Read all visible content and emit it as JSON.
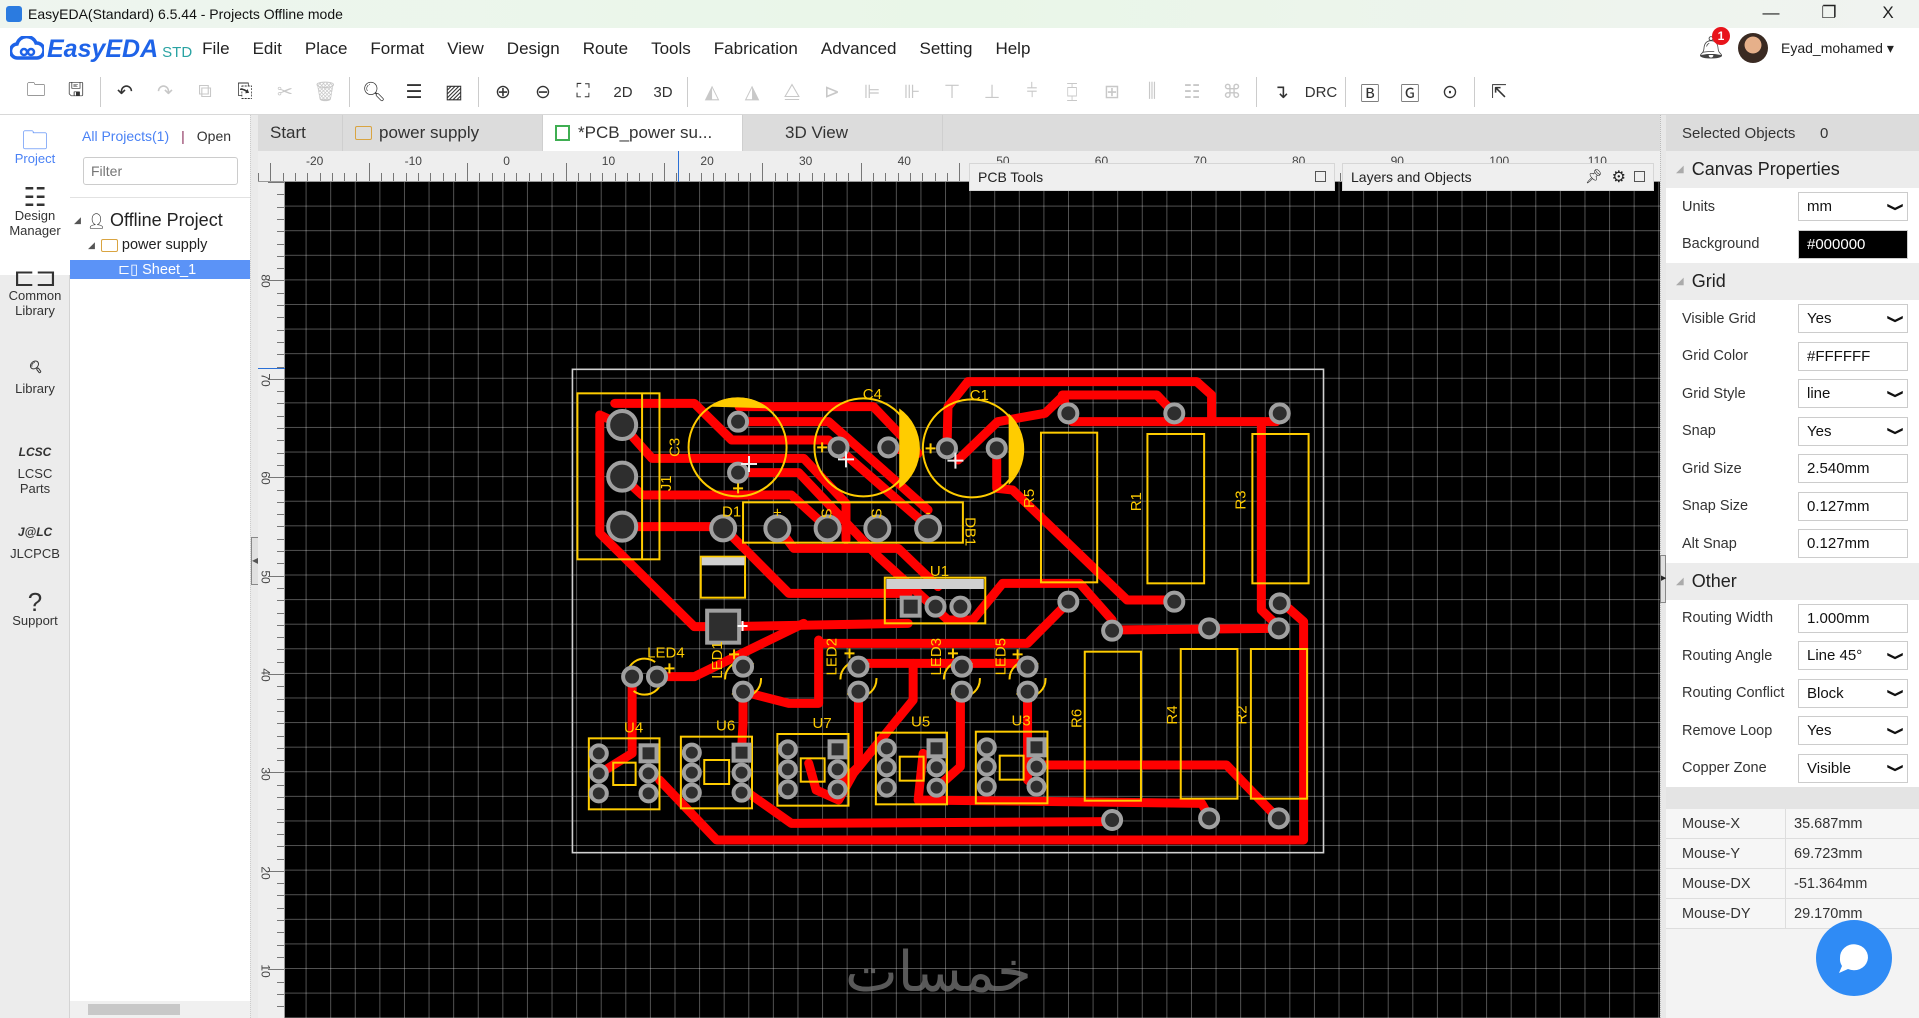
{
  "window": {
    "title": "EasyEDA(Standard) 6.5.44 - Projects Offline mode",
    "controls": [
      "—",
      "❐",
      "X"
    ]
  },
  "app": {
    "logo": "EasyEDA",
    "edition": "STD"
  },
  "menus": [
    "File",
    "Edit",
    "Place",
    "Format",
    "View",
    "Design",
    "Route",
    "Tools",
    "Fabrication",
    "Advanced",
    "Setting",
    "Help"
  ],
  "user": {
    "name": "Eyad_mohamed ▾",
    "notifications": "1"
  },
  "toolbar": [
    {
      "icon": "open-folder-icon",
      "g": "🗀",
      "off": false
    },
    {
      "icon": "save-icon",
      "g": "🖫",
      "off": false
    },
    {
      "sep": true
    },
    {
      "icon": "undo-icon",
      "g": "↶",
      "off": false
    },
    {
      "icon": "redo-icon",
      "g": "↷",
      "off": true
    },
    {
      "icon": "duplicate-icon",
      "g": "⧉",
      "off": true
    },
    {
      "icon": "paste-icon",
      "g": "⎘",
      "off": false
    },
    {
      "icon": "cut-icon",
      "g": "✂",
      "off": true
    },
    {
      "icon": "delete-icon",
      "g": "🗑",
      "off": true
    },
    {
      "sep": true
    },
    {
      "icon": "search-icon",
      "g": "🔍︎",
      "off": false
    },
    {
      "icon": "find-component-icon",
      "g": "☰",
      "off": false
    },
    {
      "icon": "erase-icon",
      "g": "▨",
      "off": false
    },
    {
      "sep": true
    },
    {
      "icon": "zoom-in-icon",
      "g": "⊕",
      "off": false
    },
    {
      "icon": "zoom-out-icon",
      "g": "⊖",
      "off": false
    },
    {
      "icon": "fit-view-icon",
      "g": "⛶",
      "off": false
    },
    {
      "icon": "view-2d",
      "t": "2D",
      "off": false
    },
    {
      "icon": "view-3d",
      "t": "3D",
      "off": false
    },
    {
      "sep": true
    },
    {
      "icon": "rotate-left-icon",
      "g": "◭",
      "off": true
    },
    {
      "icon": "rotate-right-icon",
      "g": "◮",
      "off": true
    },
    {
      "icon": "flip-h-icon",
      "g": "⧋",
      "off": true
    },
    {
      "icon": "flip-v-icon",
      "g": "⊳",
      "off": true
    },
    {
      "icon": "align-left-icon",
      "g": "⊫",
      "off": true
    },
    {
      "icon": "align-right-icon",
      "g": "⊪",
      "off": true
    },
    {
      "icon": "align-top-icon",
      "g": "⊤",
      "off": true
    },
    {
      "icon": "align-bottom-icon",
      "g": "⊥",
      "off": true
    },
    {
      "icon": "align-center-v-icon",
      "g": "⫩",
      "off": true
    },
    {
      "icon": "align-center-h-icon",
      "g": "⧮",
      "off": true
    },
    {
      "icon": "grid-align-icon",
      "g": "⊞",
      "off": true
    },
    {
      "icon": "distribute-h-icon",
      "g": "⫼",
      "off": true
    },
    {
      "icon": "distribute-v-icon",
      "g": "☷",
      "off": true
    },
    {
      "icon": "align-grid-icon",
      "g": "⌘",
      "off": true
    },
    {
      "sep": true
    },
    {
      "icon": "route-icon",
      "g": "↴",
      "off": false
    },
    {
      "icon": "drc-button",
      "t": "DRC",
      "off": false
    },
    {
      "sep": true
    },
    {
      "icon": "bom-icon",
      "g": "🄱",
      "off": false
    },
    {
      "icon": "gerber-icon",
      "g": "🄶",
      "off": false
    },
    {
      "icon": "pick-place-icon",
      "g": "⊙",
      "off": false
    },
    {
      "sep": true
    },
    {
      "icon": "import-changes-icon",
      "g": "⇱",
      "off": false
    }
  ],
  "rail": [
    {
      "name": "project",
      "label": "Project",
      "g": "🗀"
    },
    {
      "name": "design-manager",
      "label": "Design\nManager",
      "g": "☷"
    },
    {
      "name": "common-library",
      "label": "Common\nLibrary",
      "g": "⊏⊐"
    },
    {
      "name": "library",
      "label": "Library",
      "g": "🔍︎"
    },
    {
      "name": "lcsc-parts",
      "label": "LCSC\nParts",
      "g": "LCSC"
    },
    {
      "name": "jlcpcb",
      "label": "JLCPCB",
      "g": "J@LC"
    },
    {
      "name": "support",
      "label": "Support",
      "g": "?"
    }
  ],
  "project_panel": {
    "all_projects": "All Projects(1)",
    "divider": "|",
    "open": "Open",
    "filter_placeholder": "Filter",
    "tree": {
      "root": "Offline Project",
      "folder": "power supply",
      "sheet": "Sheet_1"
    }
  },
  "tabs": [
    {
      "label": "Start"
    },
    {
      "label": "power supply"
    },
    {
      "label": "*PCB_power su..."
    },
    {
      "label": "3D View"
    }
  ],
  "ruler": {
    "top": [
      "-20",
      "-10",
      "0",
      "10",
      "20",
      "30",
      "40",
      "50",
      "60",
      "70",
      "80",
      "90",
      "100",
      "110"
    ],
    "left": [
      "80",
      "70",
      "60",
      "50",
      "40",
      "30",
      "20",
      "10"
    ]
  },
  "floating": {
    "pcb_tools": "PCB Tools",
    "layers": "Layers and Objects"
  },
  "properties": {
    "selected_label": "Selected Objects",
    "selected_count": "0",
    "canvas_header": "Canvas Properties",
    "canvas_rows": [
      {
        "label": "Units",
        "value": "mm",
        "select": true
      },
      {
        "label": "Background",
        "value": "#000000",
        "select": false
      }
    ],
    "grid_header": "Grid",
    "grid_rows": [
      {
        "label": "Visible Grid",
        "value": "Yes",
        "select": true
      },
      {
        "label": "Grid Color",
        "value": "#FFFFFF",
        "select": false
      },
      {
        "label": "Grid Style",
        "value": "line",
        "select": true
      },
      {
        "label": "Snap",
        "value": "Yes",
        "select": true
      },
      {
        "label": "Grid Size",
        "value": "2.540mm",
        "select": false
      },
      {
        "label": "Snap Size",
        "value": "0.127mm",
        "select": false
      },
      {
        "label": "Alt Snap",
        "value": "0.127mm",
        "select": false
      }
    ],
    "other_header": "Other",
    "other_rows": [
      {
        "label": "Routing Width",
        "value": "1.000mm",
        "select": false
      },
      {
        "label": "Routing Angle",
        "value": "Line 45°",
        "select": true
      },
      {
        "label": "Routing Conflict",
        "value": "Block",
        "select": true
      },
      {
        "label": "Remove Loop",
        "value": "Yes",
        "select": true
      },
      {
        "label": "Copper Zone",
        "value": "Visible",
        "select": true
      }
    ],
    "mouse": [
      {
        "label": "Mouse-X",
        "value": "35.687mm"
      },
      {
        "label": "Mouse-Y",
        "value": "69.723mm"
      },
      {
        "label": "Mouse-DX",
        "value": "-51.364mm"
      },
      {
        "label": "Mouse-DY",
        "value": "29.170mm"
      }
    ]
  },
  "pcb": {
    "colors": {
      "trace": "#FF0000",
      "silkscreen": "#FFCC00",
      "pad": "#A0A0A0",
      "outline": "#D0D0D0"
    },
    "labels": [
      "C3",
      "C4",
      "C1",
      "D1",
      "DB1",
      "U1",
      "R5",
      "R1",
      "R3",
      "LED4",
      "LED1",
      "LED2",
      "LED3",
      "LED5",
      "U4",
      "U6",
      "U7",
      "U5",
      "U3",
      "R6",
      "R4",
      "R2",
      "J1",
      "+",
      "S",
      "S",
      "-"
    ]
  },
  "watermark": "خمسات",
  "chat_button": {
    "icon": "chat-bubble-icon",
    "color": "#2F8BF5"
  }
}
